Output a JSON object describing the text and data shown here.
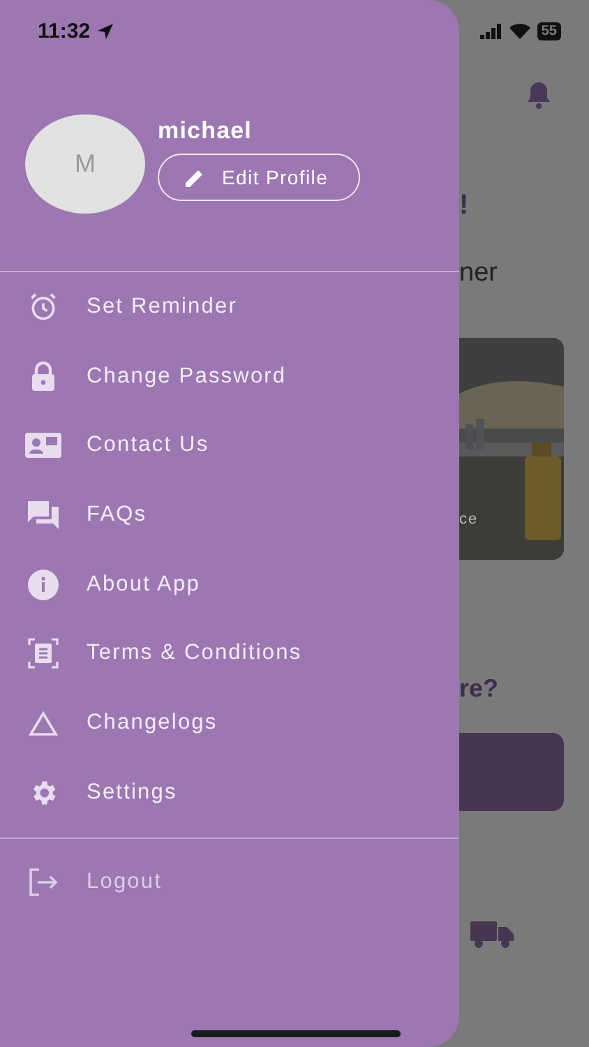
{
  "status_bar": {
    "time": "11:32",
    "battery": "55"
  },
  "drawer": {
    "profile": {
      "initial": "M",
      "name": "michael",
      "edit_button": "Edit Profile"
    },
    "menu": [
      {
        "label": "Set Reminder",
        "kind": "normal"
      },
      {
        "label": "Change Password",
        "kind": "normal"
      },
      {
        "label": "Contact Us",
        "kind": "normal"
      },
      {
        "label": "FAQs",
        "kind": "normal"
      },
      {
        "label": "About App",
        "kind": "normal"
      },
      {
        "label": "Terms & Conditions",
        "kind": "normal"
      },
      {
        "label": "Changelogs",
        "kind": "normal"
      },
      {
        "label": "Settings",
        "kind": "normal"
      }
    ],
    "logout": {
      "label": "Logout",
      "kind": "muted"
    }
  },
  "background": {
    "heading_end": "!",
    "subheading_end": "ner",
    "card_text": "ce",
    "question_end": "re?"
  }
}
